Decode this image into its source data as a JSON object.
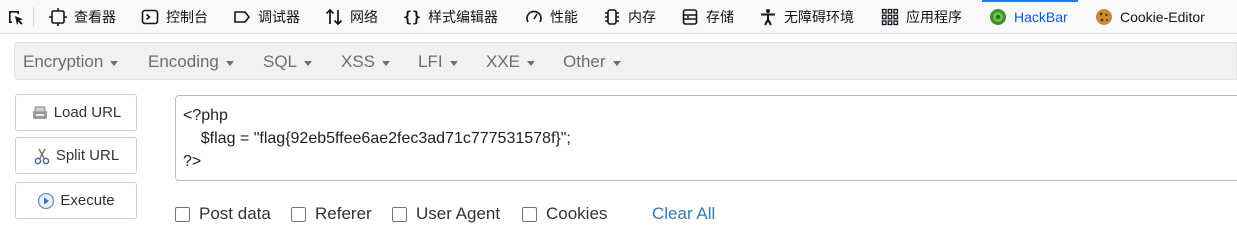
{
  "devtools": {
    "tabs": [
      {
        "label": "查看器",
        "icon": "inspector-icon"
      },
      {
        "label": "控制台",
        "icon": "console-icon"
      },
      {
        "label": "调试器",
        "icon": "debugger-icon"
      },
      {
        "label": "网络",
        "icon": "network-icon"
      },
      {
        "label": "样式编辑器",
        "icon": "style-editor-icon"
      },
      {
        "label": "性能",
        "icon": "performance-icon"
      },
      {
        "label": "内存",
        "icon": "memory-icon"
      },
      {
        "label": "存储",
        "icon": "storage-icon"
      },
      {
        "label": "无障碍环境",
        "icon": "accessibility-icon"
      },
      {
        "label": "应用程序",
        "icon": "application-icon"
      },
      {
        "label": "HackBar",
        "icon": "hackbar-icon",
        "active": true
      },
      {
        "label": "Cookie-Editor",
        "icon": "cookie-icon"
      }
    ]
  },
  "menu": {
    "items": [
      "Encryption",
      "Encoding",
      "SQL",
      "XSS",
      "LFI",
      "XXE",
      "Other"
    ]
  },
  "buttons": {
    "load": "Load URL",
    "split": "Split URL",
    "execute": "Execute"
  },
  "url_box": {
    "value": "<?php\n    $flag = \"flag{92eb5ffee6ae2fec3ad71c777531578f}\";\n?>"
  },
  "options": {
    "post_data": "Post data",
    "referer": "Referer",
    "user_agent": "User Agent",
    "cookies": "Cookies",
    "clear_all": "Clear All"
  },
  "colors": {
    "active_tab": "#0a5bd8",
    "link": "#337ab7",
    "menu_bg": "#f1f1f1"
  }
}
